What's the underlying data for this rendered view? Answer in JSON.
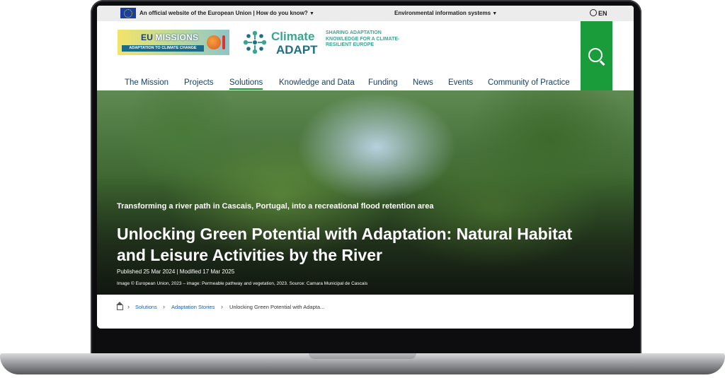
{
  "eu_bar": {
    "official_text": "An official website of the European Union | How do you know?",
    "env_menu": "Environmental information systems",
    "language": "EN"
  },
  "header": {
    "missions_logo": {
      "line1a": "EU",
      "line1b": "MISSIONS",
      "line2": "ADAPTATION TO CLIMATE CHANGE"
    },
    "climate_adapt": {
      "name_line1": "Climate",
      "name_line2": "ADAPT"
    },
    "tagline": "SHARING ADAPTATION KNOWLEDGE FOR A CLIMATE-RESILIENT EUROPE",
    "search_icon": "search-icon"
  },
  "nav": {
    "items": [
      {
        "label": "The Mission"
      },
      {
        "label": "Projects"
      },
      {
        "label": "Solutions",
        "active": true
      },
      {
        "label": "Knowledge and Data"
      },
      {
        "label": "Funding"
      },
      {
        "label": "News"
      },
      {
        "label": "Events"
      },
      {
        "label": "Community of Practice"
      }
    ]
  },
  "hero": {
    "subtitle": "Transforming a river path in Cascais, Portugal, into a recreational flood retention area",
    "title": "Unlocking Green Potential with Adaptation: Natural Habitat and Leisure Activities by the River",
    "dates": "Published 25 Mar 2024 | Modified 17 Mar 2025",
    "credit": "Image  ©  European Union, 2023 – image: Permeable pathway and vegetation, 2023. Source: Camara Municipal de Cascais"
  },
  "breadcrumb": {
    "home_icon": "home-icon",
    "items": [
      "Solutions",
      "Adaptation Stories"
    ],
    "current": "Unlocking Green Potential with Adapta..."
  },
  "colors": {
    "accent_green": "#1a9c3a",
    "nav_text": "#16406a",
    "brand_teal": "#3aa590",
    "link_blue": "#1a5fa3"
  }
}
